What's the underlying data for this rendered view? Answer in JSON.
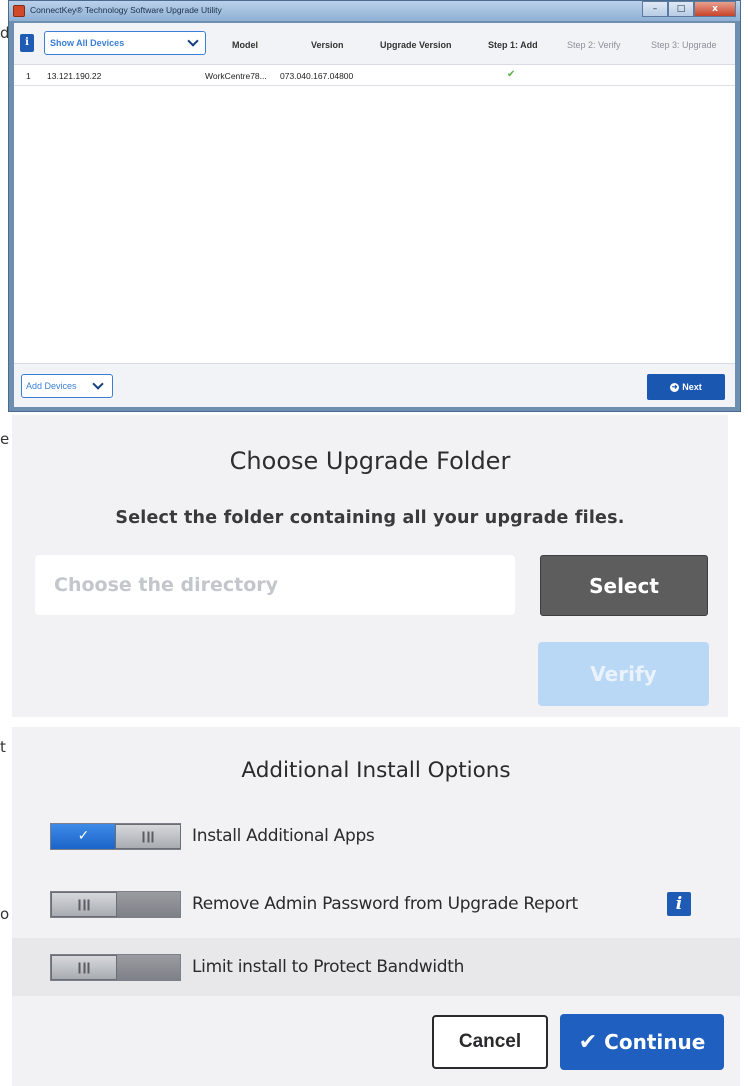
{
  "edge_fragments": [
    "d",
    "e",
    "t",
    "o"
  ],
  "window": {
    "title": "ConnectKey® Technology Software Upgrade Utility",
    "buttons": {
      "minimize": "–",
      "maximize": "□",
      "close": "x"
    }
  },
  "grid": {
    "info_icon": "i",
    "filter_selected": "Show All Devices",
    "columns": {
      "model": "Model",
      "version": "Version",
      "upgrade_version": "Upgrade Version",
      "step1": "Step 1: Add",
      "step2": "Step 2: Verify",
      "step3": "Step 3: Upgrade"
    },
    "rows": [
      {
        "index": "1",
        "ip": "13.121.190.22",
        "model": "WorkCentre78...",
        "version": "073.040.167.04800",
        "upgrade_version": "",
        "step1": "✔",
        "step2": "",
        "step3": ""
      }
    ],
    "add_devices_label": "Add Devices",
    "next_label": "Next"
  },
  "upgrade_folder": {
    "title": "Choose Upgrade Folder",
    "subtitle": "Select the folder containing all your upgrade files.",
    "directory_placeholder": "Choose the directory",
    "directory_value": "",
    "select_label": "Select",
    "verify_label": "Verify"
  },
  "install_options": {
    "title": "Additional Install Options",
    "options": [
      {
        "label": "Install Additional Apps",
        "enabled": true
      },
      {
        "label": "Remove Admin Password from Upgrade Report",
        "enabled": false,
        "info_icon": "i"
      },
      {
        "label": "Limit install to Protect Bandwidth",
        "enabled": false
      }
    ],
    "cancel_label": "Cancel",
    "continue_label": "Continue"
  },
  "colors": {
    "accent_blue": "#1e5fbf",
    "select_gray": "#5d5d5d",
    "verify_disabled": "#b9d8f6",
    "check_green": "#58b046"
  }
}
